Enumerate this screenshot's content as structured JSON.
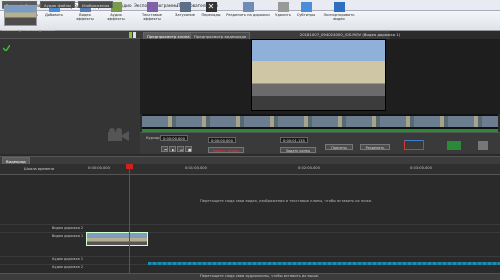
{
  "menu": {
    "main_button": "Меню",
    "items": [
      "Главная",
      "Клипы",
      "Видеоряд",
      "Эффекты",
      "Аудио",
      "Экспорт",
      "Программы",
      "Пользовательская"
    ],
    "active_index": 2
  },
  "ribbon": {
    "buttons": [
      "Новый",
      "Удалить",
      "Добавить",
      "Видео эффекты",
      "Аудио эффекты",
      "Текстовые эффекты",
      "Затухание",
      "Переходы",
      "Разделить на дорожки",
      "Удалить",
      "Субтитры",
      "Экспортировать видео"
    ]
  },
  "library": {
    "tabs": [
      "Видео файлы",
      "Аудио файлы",
      "Изображения"
    ],
    "thumb_caption": "20181007_094024000_iOS.MOV"
  },
  "preview": {
    "tabs": [
      "Предпросмотр клипа",
      "Предпросмотр видеоряда"
    ],
    "title": "20181007_094024000_iOS.MOV (Видео дорожка 1)"
  },
  "controls": {
    "cursor_label": "Курсор:",
    "cursor_value": "0:00:00.000",
    "current_value": "0:00:00.000",
    "end_value": "0:00:01.135",
    "set_start": "Задать начало",
    "set_end": "Задать конец",
    "preset": "Пресеты",
    "split": "Разделить"
  },
  "timeline": {
    "tab": "Видеоряд",
    "scale_label": "Шкала времени",
    "ticks": [
      "0:00:00.000",
      "0:01:00.000",
      "0:02:00.000",
      "0:03:00.000"
    ],
    "drop_hint": "Перетащите сюда свои видео, изображения и текстовые клипы, чтобы вставить их ниже.",
    "tracks": [
      "Видео дорожка 2",
      "Видео дорожка 1",
      "Аудио дорожка 1",
      "Аудио дорожка 2"
    ]
  },
  "status": {
    "hint": "Перетащите сюда свои аудиоклипы, чтобы вставить их выше."
  }
}
